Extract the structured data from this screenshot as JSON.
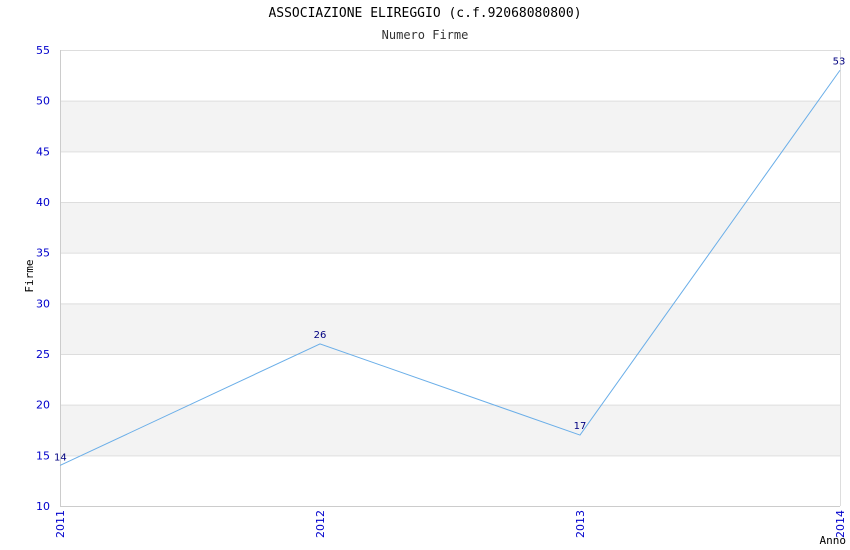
{
  "chart_data": {
    "type": "line",
    "title": "ASSOCIAZIONE ELIREGGIO (c.f.92068080800)",
    "subtitle": "Numero Firme",
    "xlabel": "Anno",
    "ylabel": "Firme",
    "x": [
      "2011",
      "2012",
      "2013",
      "2014"
    ],
    "values": [
      14,
      26,
      17,
      53
    ],
    "ylim": [
      10,
      55
    ],
    "yticks": [
      10,
      15,
      20,
      25,
      30,
      35,
      40,
      45,
      50,
      55
    ],
    "grid": true,
    "colors": {
      "line": "#6aaee8",
      "band": "#f3f3f3",
      "grid": "#dddddd",
      "tick_text": "#0000cc",
      "data_label": "#000080"
    }
  }
}
